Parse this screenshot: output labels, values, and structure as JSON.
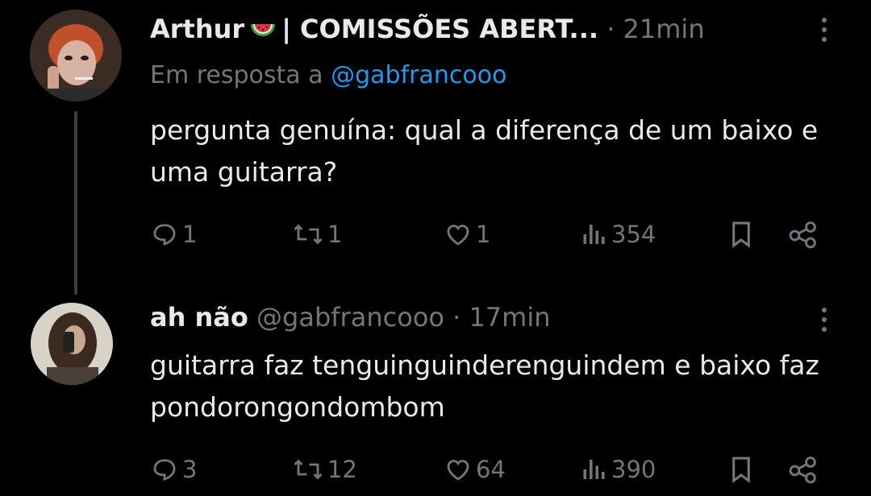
{
  "tweets": [
    {
      "author_name": "Arthur",
      "author_suffix": "| COMISSÕES ABERT...",
      "time": "· 21min",
      "reply_prefix": "Em resposta a",
      "reply_to": "@gabfrancooo",
      "text": "pergunta genuína: qual a diferença de um baixo e uma guitarra?",
      "stats": {
        "replies": "1",
        "retweets": "1",
        "likes": "1",
        "views": "354"
      }
    },
    {
      "author_name": "ah não",
      "handle": "@gabfrancooo",
      "time": "· 17min",
      "text": "guitarra faz  tenguinguinderenguindem e baixo faz pondorongondombom",
      "stats": {
        "replies": "3",
        "retweets": "12",
        "likes": "64",
        "views": "390"
      }
    }
  ],
  "colors": {
    "background": "#000000",
    "text": "#e7e9ea",
    "muted": "#71767b",
    "accent": "#1d9bf0"
  },
  "icons": [
    "watermelon-icon",
    "more-options-icon",
    "reply-icon",
    "retweet-icon",
    "like-icon",
    "views-icon",
    "bookmark-icon",
    "share-icon"
  ]
}
